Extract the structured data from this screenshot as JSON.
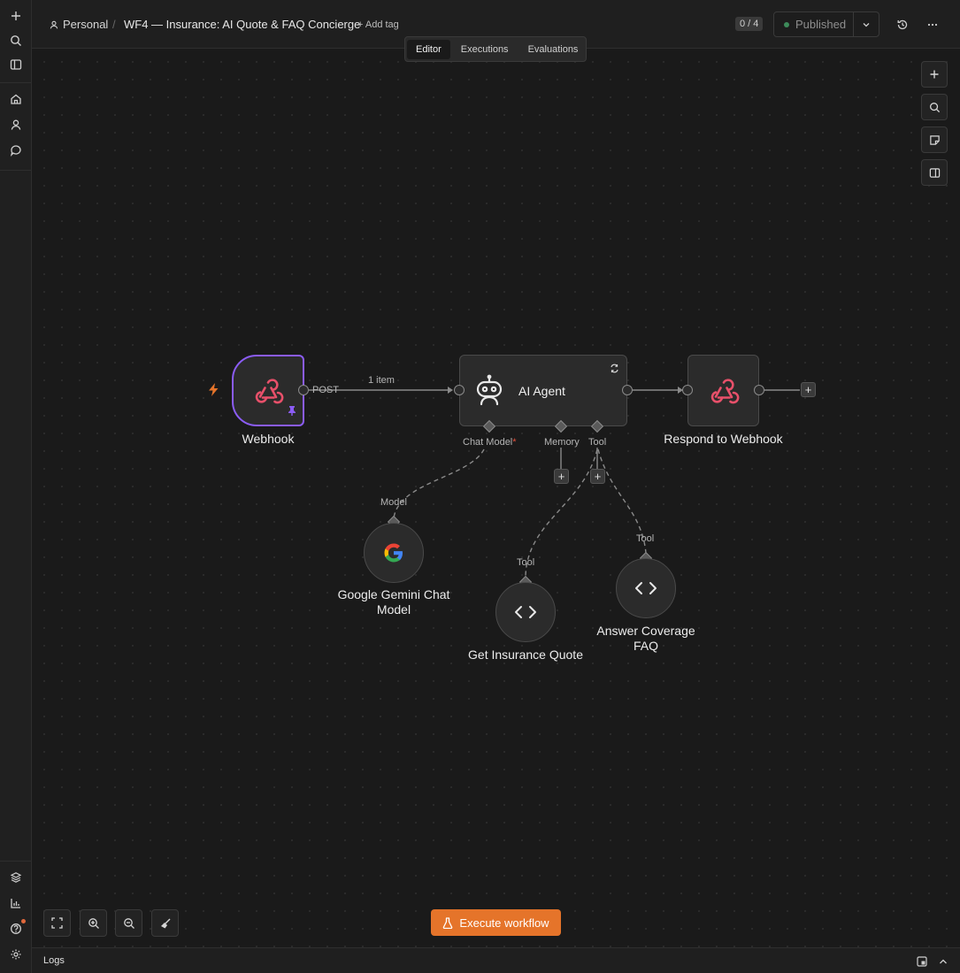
{
  "breadcrumb": {
    "project": "Personal",
    "separator": "/",
    "workflow_name": "WF4 — Insurance: AI Quote & FAQ Concierge",
    "add_tag": "+ Add tag"
  },
  "header": {
    "counter": "0 / 4",
    "publish_status": "Published"
  },
  "tabs": [
    {
      "label": "Editor",
      "active": true
    },
    {
      "label": "Executions",
      "active": false
    },
    {
      "label": "Evaluations",
      "active": false
    }
  ],
  "nodes": {
    "webhook": {
      "label": "Webhook",
      "output_label": "POST"
    },
    "connection_count": "1 item",
    "agent": {
      "label": "AI Agent",
      "port_chat_model": "Chat Model",
      "port_memory": "Memory",
      "port_tool": "Tool",
      "required_marker": "*"
    },
    "respond": {
      "label": "Respond to Webhook"
    },
    "gemini": {
      "label": "Google Gemini Chat Model",
      "port_label": "Model"
    },
    "quote": {
      "label": "Get Insurance Quote",
      "port_label": "Tool"
    },
    "faq": {
      "label": "Answer Coverage FAQ",
      "port_label": "Tool"
    }
  },
  "footer": {
    "execute_label": "Execute workflow",
    "logs_label": "Logs"
  },
  "colors": {
    "accent": "#e5742a",
    "pinned": "#8b5cf6",
    "webhook_icon": "#e8506a",
    "published_dot": "#3d8b5a"
  }
}
